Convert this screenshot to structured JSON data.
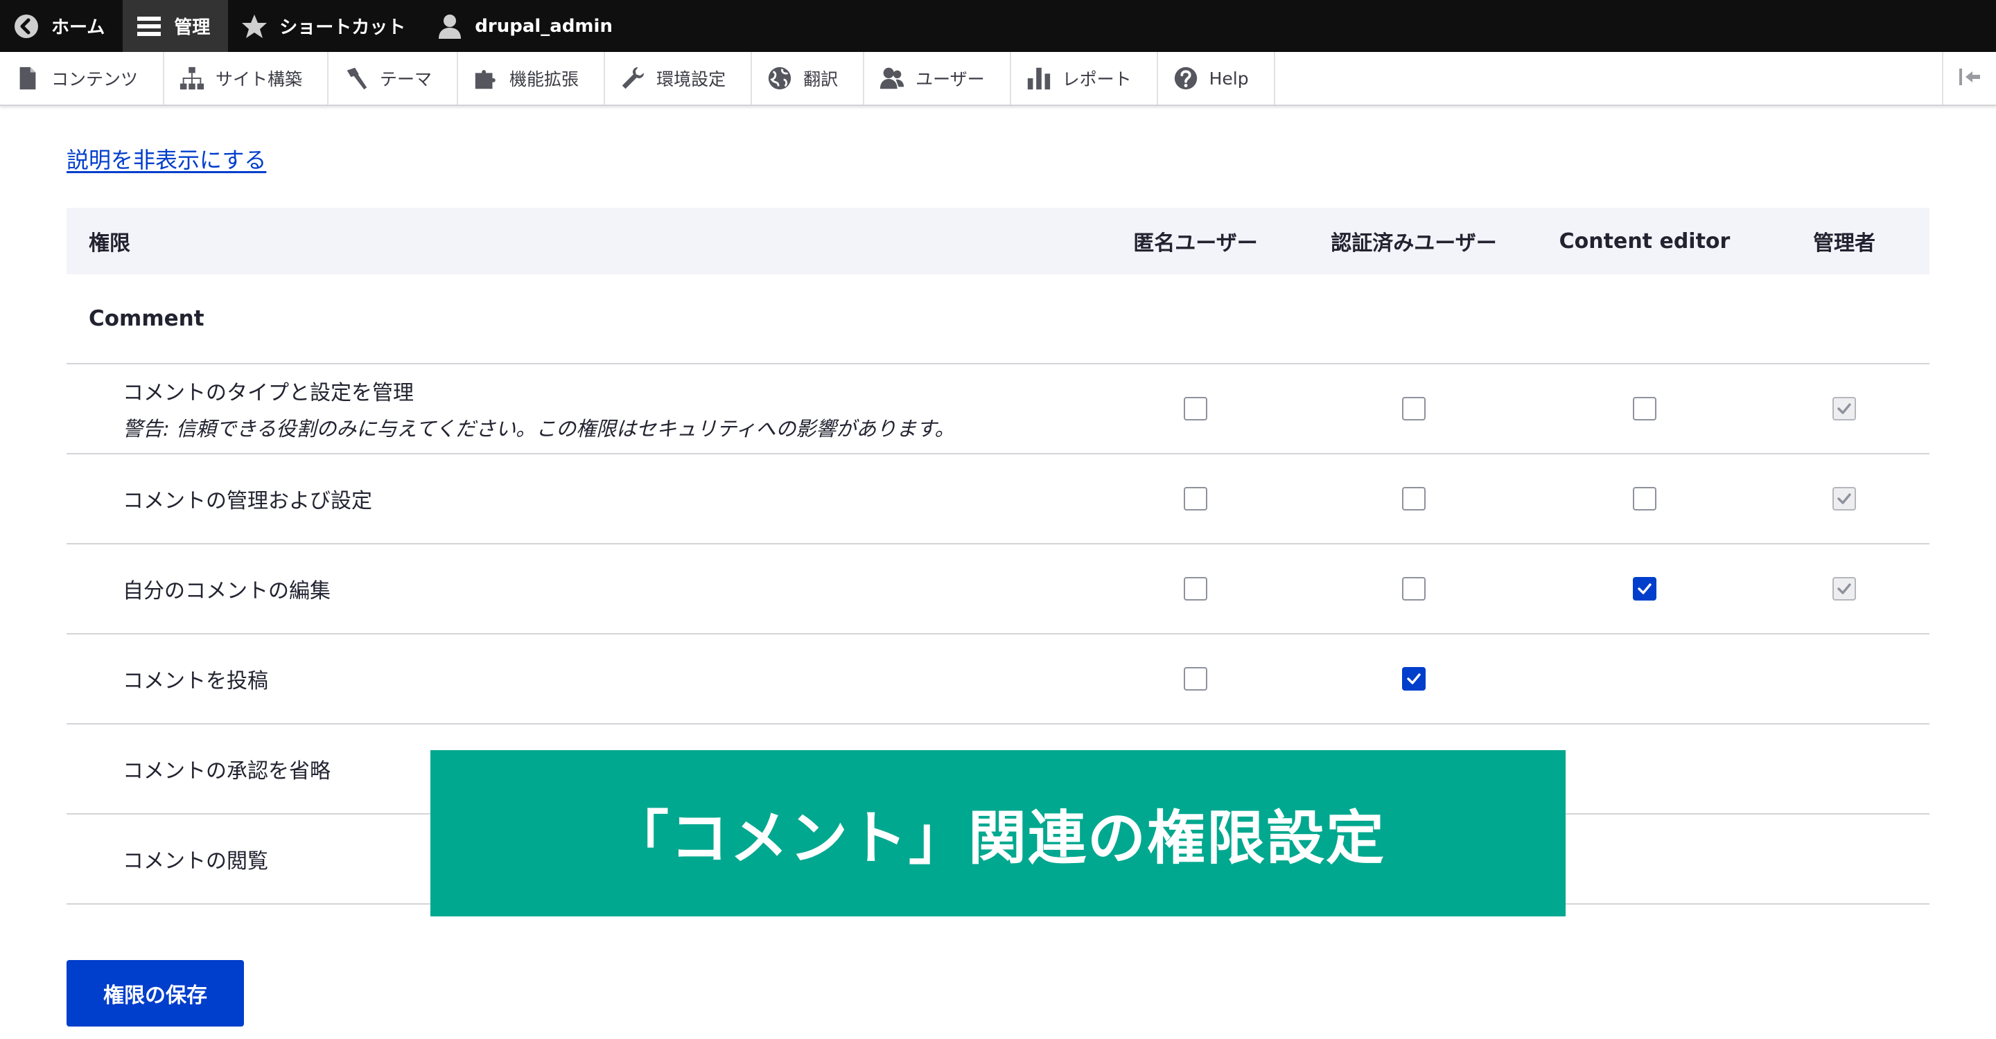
{
  "toolbar": {
    "items": [
      {
        "label": "ホーム",
        "icon": "back-circle-icon"
      },
      {
        "label": "管理",
        "icon": "hamburger-icon",
        "active": true
      },
      {
        "label": "ショートカット",
        "icon": "star-icon"
      },
      {
        "label": "drupal_admin",
        "icon": "user-icon"
      }
    ]
  },
  "tray": {
    "items": [
      {
        "label": "コンテンツ",
        "icon": "document-icon"
      },
      {
        "label": "サイト構築",
        "icon": "sitemap-icon"
      },
      {
        "label": "テーマ",
        "icon": "paintbrush-icon"
      },
      {
        "label": "機能拡張",
        "icon": "puzzle-icon"
      },
      {
        "label": "環境設定",
        "icon": "wrench-icon"
      },
      {
        "label": "翻訳",
        "icon": "globe-icon"
      },
      {
        "label": "ユーザー",
        "icon": "people-icon"
      },
      {
        "label": "レポート",
        "icon": "bar-chart-icon"
      },
      {
        "label": "Help",
        "icon": "help-icon"
      }
    ]
  },
  "toggle_description": "説明を非表示にする",
  "table": {
    "headers": {
      "permission": "権限",
      "anonymous": "匿名ユーザー",
      "authenticated": "認証済みユーザー",
      "editor": "Content editor",
      "admin": "管理者"
    },
    "group": "Comment",
    "rows": [
      {
        "name": "コメントのタイプと設定を管理",
        "warning": "警告: 信頼できる役割のみに与えてください。この権限はセキュリティへの影響があります。",
        "anonymous": "unchecked",
        "authenticated": "unchecked",
        "editor": "unchecked",
        "admin": "disabled"
      },
      {
        "name": "コメントの管理および設定",
        "warning": "",
        "anonymous": "unchecked",
        "authenticated": "unchecked",
        "editor": "unchecked",
        "admin": "disabled"
      },
      {
        "name": "自分のコメントの編集",
        "warning": "",
        "anonymous": "unchecked",
        "authenticated": "unchecked",
        "editor": "checked",
        "admin": "disabled"
      },
      {
        "name": "コメントを投稿",
        "warning": "",
        "anonymous": "unchecked",
        "authenticated": "checked",
        "editor": "",
        "admin": ""
      },
      {
        "name": "コメントの承認を省略",
        "warning": "",
        "anonymous": "",
        "authenticated": "",
        "editor": "",
        "admin": ""
      },
      {
        "name": "コメントの閲覧",
        "warning": "",
        "anonymous": "",
        "authenticated": "",
        "editor": "",
        "admin": ""
      }
    ]
  },
  "save_label": "権限の保存",
  "banner_text": "「コメント」関連の権限設定",
  "colors": {
    "accent": "#003ecc",
    "banner": "#00a88f",
    "toolbar": "#0f0f0f"
  }
}
